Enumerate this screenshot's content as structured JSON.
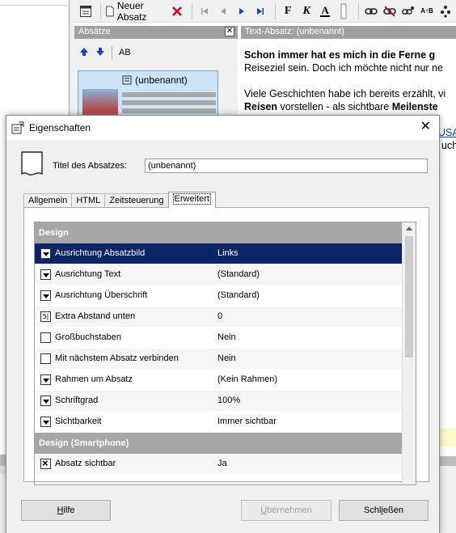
{
  "toolbar": {
    "new_paragraph_label": "Neuer Absatz",
    "font_bold": "F",
    "font_italic": "K",
    "font_color": "A",
    "case_label": "A↑B"
  },
  "paragraphs_panel": {
    "title": "Absätze",
    "tools_label": "AB",
    "card_title": "(unbenannt)"
  },
  "text_panel": {
    "title": "Text-Absatz: (unbenannt)",
    "lines": [
      {
        "bold": "Schon immer hat es mich in die Ferne g",
        "rest": ""
      },
      {
        "bold": "",
        "rest": "Reiseziel sein. Doch ich möchte nicht nur ne"
      },
      {
        "bold": "",
        "rest": ""
      },
      {
        "bold": "",
        "rest": "Viele Geschichten habe ich bereits erzählt, vi"
      },
      {
        "bold": "Reisen",
        "rest": " vorstellen - als sichtbare ",
        "bold2": "Meilenste"
      }
    ],
    "link_text": "USA",
    "trailing_text": "uch"
  },
  "dialog": {
    "title": "Eigenschaften",
    "close_glyph": "✕",
    "title_label": "Titel des Absatzes:",
    "title_value": "(unbenannt)",
    "tabs": [
      {
        "label": "Allgemein",
        "active": false
      },
      {
        "label": "HTML",
        "active": false
      },
      {
        "label": "Zeitsteuerung",
        "active": false
      },
      {
        "label": "Erweitert",
        "active": true
      }
    ],
    "sections": [
      {
        "title": "Design",
        "rows": [
          {
            "control": "dropdown",
            "label": "Ausrichtung Absatzbild",
            "value": "Links",
            "selected": true
          },
          {
            "control": "dropdown",
            "label": "Ausrichtung Text",
            "value": "(Standard)",
            "selected": false
          },
          {
            "control": "dropdown",
            "label": "Ausrichtung Überschrift",
            "value": "(Standard)",
            "selected": false
          },
          {
            "control": "spin",
            "label": "Extra Abstand unten",
            "value": "0",
            "selected": false
          },
          {
            "control": "checkbox",
            "label": "Großbuchstaben",
            "value": "Nein",
            "selected": false
          },
          {
            "control": "checkbox",
            "label": "Mit nächstem Absatz verbinden",
            "value": "Nein",
            "selected": false
          },
          {
            "control": "dropdown",
            "label": "Rahmen um Absatz",
            "value": "(Kein Rahmen)",
            "selected": false
          },
          {
            "control": "dropdown",
            "label": "Schriftgrad",
            "value": "100%",
            "selected": false
          },
          {
            "control": "dropdown",
            "label": "Sichtbarkeit",
            "value": "Immer sichtbar",
            "selected": false
          }
        ]
      },
      {
        "title": "Design (Smartphone)",
        "rows": [
          {
            "control": "checked",
            "label": "Absatz sichtbar",
            "value": "Ja",
            "selected": false
          }
        ]
      }
    ],
    "buttons": {
      "help_u": "H",
      "help_rest": "ilfe",
      "apply_u": "Ü",
      "apply_rest": "bernehmen",
      "close_pre": "Schl",
      "close_u": "i",
      "close_rest": "eßen"
    }
  },
  "colors": {
    "selection": "#0a2466",
    "section_header": "#a6a6a6",
    "link": "#0645ad",
    "delete_red": "#d0021b",
    "nav_blue": "#1f3fbf"
  }
}
